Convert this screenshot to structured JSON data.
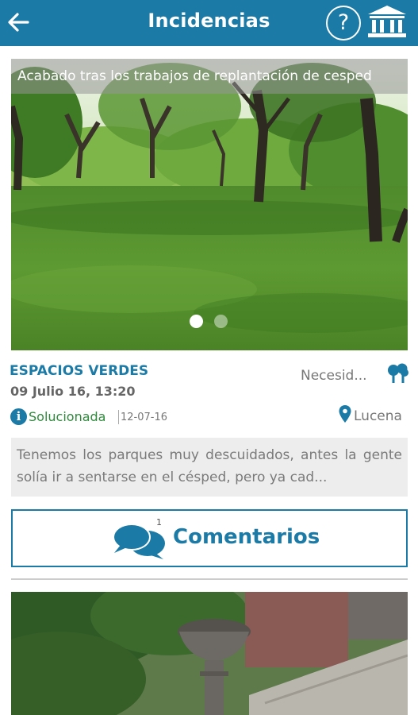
{
  "header": {
    "title": "Incidencias",
    "help_symbol": "?",
    "back_icon": "arrow-left-icon",
    "town_icon": "town-hall-icon",
    "color": "#1c7ba6"
  },
  "incident": {
    "image_caption": "Acabado tras los trabajos de replantación de cesped",
    "carousel": {
      "count": 2,
      "active": 1
    },
    "category": "ESPACIOS VERDES",
    "datetime": "09 Julio 16, 13:20",
    "type_label": "Necesid...",
    "type_icon": "trees-icon",
    "status_icon": "info-icon",
    "status": "Solucionada",
    "status_date": "12-07-16",
    "location_icon": "map-pin-icon",
    "location": "Lucena",
    "description": "Tenemos los parques muy descuidados, antes la gente solía ir a sentarse en el césped, pero ya cad...",
    "comments_icon": "chat-bubbles-icon",
    "comments_count": "1",
    "comments_label": "Comentarios",
    "status_color": "#2e8b3c"
  }
}
